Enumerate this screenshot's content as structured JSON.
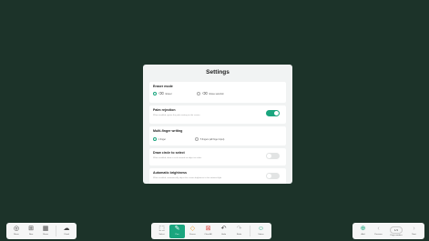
{
  "settings": {
    "title": "Settings",
    "eraser": {
      "title": "Eraser mode",
      "options": [
        {
          "label": "Eraser",
          "icon": "eraser-icon",
          "selected": true
        },
        {
          "label": "Erase selection",
          "icon": "eraser-selection-icon",
          "selected": false
        }
      ]
    },
    "palm": {
      "title": "Palm rejection",
      "desc": "When enabled, ignore the palm resting on the screen",
      "enabled": true
    },
    "multifinger": {
      "title": "Multi-finger writing",
      "options": [
        {
          "label": "1 finger",
          "selected": true
        },
        {
          "label": "5 fingers (all finger input)",
          "selected": false
        }
      ]
    },
    "circle": {
      "title": "Draw circle to select",
      "desc": "When enabled, draw a circle around an object to select",
      "enabled": false
    },
    "brightness": {
      "title": "Automatic brightness",
      "desc": "When enabled, automatically adjust the screen brightness to the ambient light",
      "enabled": false
    }
  },
  "left_toolbar": {
    "items": [
      {
        "label": "Menu",
        "icon": "menu-icon"
      },
      {
        "label": "New",
        "icon": "new-page-icon"
      },
      {
        "label": "Share",
        "icon": "share-icon"
      },
      {
        "label": "Cloud",
        "icon": "cloud-icon"
      }
    ]
  },
  "center_toolbar": {
    "items": [
      {
        "label": "Select",
        "icon": "select-icon"
      },
      {
        "label": "Pen",
        "icon": "pen-icon",
        "active": true
      },
      {
        "label": "Eraser",
        "icon": "eraser-icon"
      },
      {
        "label": "Clear All",
        "icon": "clear-all-icon"
      },
      {
        "label": "Undo",
        "icon": "undo-icon"
      },
      {
        "label": "Redo",
        "icon": "redo-icon"
      },
      {
        "label": "Status",
        "icon": "status-icon"
      }
    ]
  },
  "right_toolbar": {
    "add_label": "Add",
    "previous_label": "Previous",
    "page_indicator": "1/1",
    "page_number_label": "Page number",
    "next_label": "Next"
  }
}
